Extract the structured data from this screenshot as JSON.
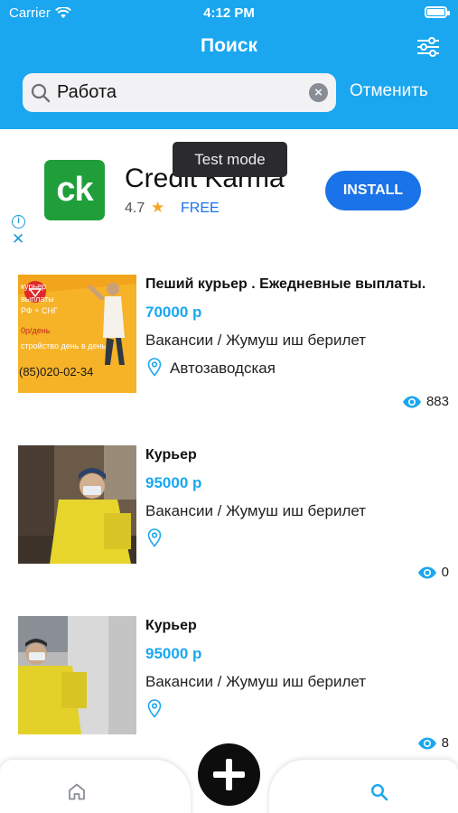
{
  "colors": {
    "accent": "#1aa7f0",
    "fab": "#0d0d0d",
    "ad_button": "#1a73e8",
    "ad_logo": "#1f9e3a"
  },
  "status_bar": {
    "carrier": "Carrier",
    "time": "4:12 PM",
    "battery_level": 1.0
  },
  "header": {
    "title": "Поиск",
    "filter_icon": "sliders-icon"
  },
  "search": {
    "value": "Работа",
    "cancel_label": "Отменить"
  },
  "ad": {
    "logo_text": "ck",
    "title": "Credit Karma",
    "rating": "4.7",
    "price": "FREE",
    "install_label": "INSTALL",
    "tooltip": "Test mode",
    "info_icon": "info-icon",
    "close_icon": "close-icon"
  },
  "listings": [
    {
      "title": "Пеший курьер . Ежедневные выплаты.",
      "price": "70000 р",
      "category": "Вакансии / Жумуш иш берилет",
      "location": "Автозаводская",
      "views": "883",
      "image_text": [
        "курьер",
        "выплаты",
        "РФ + СНГ",
        "0р/день",
        "стройство день в день",
        "(85)020-02-34"
      ]
    },
    {
      "title": "Курьер",
      "price": "95000 р",
      "category": "Вакансии / Жумуш иш берилет",
      "location": "",
      "views": "0"
    },
    {
      "title": "Курьер",
      "price": "95000 р",
      "category": "Вакансии / Жумуш иш берилет",
      "location": "",
      "views": "8"
    }
  ],
  "tabbar": {
    "home_icon": "home-icon",
    "add_icon": "plus-icon",
    "search_icon": "search-icon"
  }
}
